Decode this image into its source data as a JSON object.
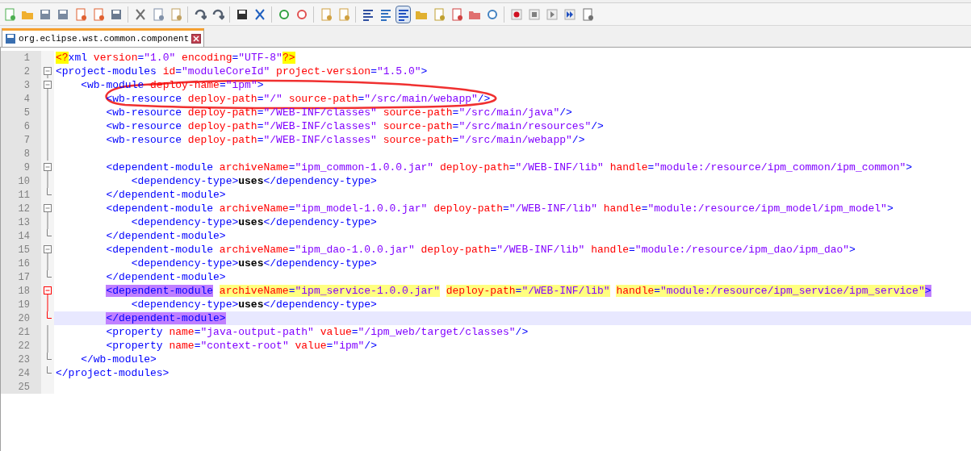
{
  "tab": {
    "title": "org.eclipse.wst.common.component",
    "selected": true
  },
  "lines": [
    {
      "number": "1",
      "segments": [
        {
          "kind": "pi",
          "text": "<?"
        },
        {
          "kind": "tag",
          "text": "xml "
        },
        {
          "kind": "attr",
          "text": "version"
        },
        {
          "kind": "eq",
          "text": "="
        },
        {
          "kind": "val",
          "text": "\"1.0\" "
        },
        {
          "kind": "attr",
          "text": "encoding"
        },
        {
          "kind": "eq",
          "text": "="
        },
        {
          "kind": "val",
          "text": "\"UTF-8\""
        },
        {
          "kind": "pi",
          "text": "?>"
        }
      ]
    },
    {
      "number": "2",
      "kind": "open",
      "active": false,
      "current": false,
      "segments": [
        {
          "kind": "tag",
          "text": "<project-modules "
        },
        {
          "kind": "attr",
          "text": "id"
        },
        {
          "kind": "eq",
          "text": "="
        },
        {
          "kind": "val",
          "text": "\"moduleCoreId\" "
        },
        {
          "kind": "attr",
          "text": "project-version"
        },
        {
          "kind": "eq",
          "text": "="
        },
        {
          "kind": "val",
          "text": "\"1.5.0\""
        },
        {
          "kind": "tag",
          "text": ">"
        }
      ]
    },
    {
      "number": "3",
      "kind": "open",
      "active": false,
      "current": false,
      "segments": [
        {
          "kind": "tag",
          "text": "    <wb-module "
        },
        {
          "kind": "attr",
          "text": "deploy-name"
        },
        {
          "kind": "eq",
          "text": "="
        },
        {
          "kind": "val",
          "text": "\"ipm\""
        },
        {
          "kind": "tag",
          "text": ">"
        }
      ]
    },
    {
      "number": "4",
      "kind": "line",
      "active": false,
      "current": false,
      "segments": [
        {
          "kind": "tag",
          "text": "        <wb-resource "
        },
        {
          "kind": "attr",
          "text": "deploy-path"
        },
        {
          "kind": "eq",
          "text": "="
        },
        {
          "kind": "val",
          "text": "\"/\" "
        },
        {
          "kind": "attr",
          "text": "source-path"
        },
        {
          "kind": "eq",
          "text": "="
        },
        {
          "kind": "val",
          "text": "\"/src/main/webapp\""
        },
        {
          "kind": "tag",
          "text": "/>"
        }
      ]
    },
    {
      "number": "5",
      "kind": "line",
      "active": false,
      "current": false,
      "segments": [
        {
          "kind": "tag",
          "text": "        <wb-resource "
        },
        {
          "kind": "attr",
          "text": "deploy-path"
        },
        {
          "kind": "eq",
          "text": "="
        },
        {
          "kind": "val",
          "text": "\"/WEB-INF/classes\" "
        },
        {
          "kind": "attr",
          "text": "source-path"
        },
        {
          "kind": "eq",
          "text": "="
        },
        {
          "kind": "val",
          "text": "\"/src/main/java\""
        },
        {
          "kind": "tag",
          "text": "/>"
        }
      ]
    },
    {
      "number": "6",
      "kind": "line",
      "active": false,
      "current": false,
      "segments": [
        {
          "kind": "tag",
          "text": "        <wb-resource "
        },
        {
          "kind": "attr",
          "text": "deploy-path"
        },
        {
          "kind": "eq",
          "text": "="
        },
        {
          "kind": "val",
          "text": "\"/WEB-INF/classes\" "
        },
        {
          "kind": "attr",
          "text": "source-path"
        },
        {
          "kind": "eq",
          "text": "="
        },
        {
          "kind": "val",
          "text": "\"/src/main/resources\""
        },
        {
          "kind": "tag",
          "text": "/>"
        }
      ]
    },
    {
      "number": "7",
      "kind": "line",
      "active": false,
      "current": false,
      "segments": [
        {
          "kind": "tag",
          "text": "        <wb-resource "
        },
        {
          "kind": "attr",
          "text": "deploy-path"
        },
        {
          "kind": "eq",
          "text": "="
        },
        {
          "kind": "val",
          "text": "\"/WEB-INF/classes\" "
        },
        {
          "kind": "attr",
          "text": "source-path"
        },
        {
          "kind": "eq",
          "text": "="
        },
        {
          "kind": "val",
          "text": "\"/src/main/webapp\""
        },
        {
          "kind": "tag",
          "text": "/>"
        }
      ]
    },
    {
      "number": "8",
      "kind": "line",
      "active": false,
      "current": false
    },
    {
      "number": "9",
      "kind": "open",
      "active": false,
      "current": false,
      "segments": [
        {
          "kind": "tag",
          "text": "        <dependent-module "
        },
        {
          "kind": "attr",
          "text": "archiveName"
        },
        {
          "kind": "eq",
          "text": "="
        },
        {
          "kind": "val",
          "text": "\"ipm_common-1.0.0.jar\" "
        },
        {
          "kind": "attr",
          "text": "deploy-path"
        },
        {
          "kind": "eq",
          "text": "="
        },
        {
          "kind": "val",
          "text": "\"/WEB-INF/lib\" "
        },
        {
          "kind": "attr",
          "text": "handle"
        },
        {
          "kind": "eq",
          "text": "="
        },
        {
          "kind": "val",
          "text": "\"module:/resource/ipm_common/ipm_common\""
        },
        {
          "kind": "tag",
          "text": ">"
        }
      ]
    },
    {
      "number": "10",
      "kind": "line",
      "active": false,
      "current": false,
      "segments": [
        {
          "kind": "tag",
          "text": "            <dependency-type>"
        },
        {
          "kind": "text",
          "text": "uses"
        },
        {
          "kind": "tag",
          "text": "</dependency-type>"
        }
      ]
    },
    {
      "number": "11",
      "kind": "end",
      "active": false,
      "current": false,
      "segments": [
        {
          "kind": "tag",
          "text": "        </dependent-module>"
        }
      ]
    },
    {
      "number": "12",
      "kind": "open",
      "active": false,
      "current": false,
      "segments": [
        {
          "kind": "tag",
          "text": "        <dependent-module "
        },
        {
          "kind": "attr",
          "text": "archiveName"
        },
        {
          "kind": "eq",
          "text": "="
        },
        {
          "kind": "val",
          "text": "\"ipm_model-1.0.0.jar\" "
        },
        {
          "kind": "attr",
          "text": "deploy-path"
        },
        {
          "kind": "eq",
          "text": "="
        },
        {
          "kind": "val",
          "text": "\"/WEB-INF/lib\" "
        },
        {
          "kind": "attr",
          "text": "handle"
        },
        {
          "kind": "eq",
          "text": "="
        },
        {
          "kind": "val",
          "text": "\"module:/resource/ipm_model/ipm_model\""
        },
        {
          "kind": "tag",
          "text": ">"
        }
      ]
    },
    {
      "number": "13",
      "kind": "line",
      "active": false,
      "current": false,
      "segments": [
        {
          "kind": "tag",
          "text": "            <dependency-type>"
        },
        {
          "kind": "text",
          "text": "uses"
        },
        {
          "kind": "tag",
          "text": "</dependency-type>"
        }
      ]
    },
    {
      "number": "14",
      "kind": "end",
      "active": false,
      "current": false,
      "segments": [
        {
          "kind": "tag",
          "text": "        </dependent-module>"
        }
      ]
    },
    {
      "number": "15",
      "kind": "open",
      "active": false,
      "current": false,
      "segments": [
        {
          "kind": "tag",
          "text": "        <dependent-module "
        },
        {
          "kind": "attr",
          "text": "archiveName"
        },
        {
          "kind": "eq",
          "text": "="
        },
        {
          "kind": "val",
          "text": "\"ipm_dao-1.0.0.jar\" "
        },
        {
          "kind": "attr",
          "text": "deploy-path"
        },
        {
          "kind": "eq",
          "text": "="
        },
        {
          "kind": "val",
          "text": "\"/WEB-INF/lib\" "
        },
        {
          "kind": "attr",
          "text": "handle"
        },
        {
          "kind": "eq",
          "text": "="
        },
        {
          "kind": "val",
          "text": "\"module:/resource/ipm_dao/ipm_dao\""
        },
        {
          "kind": "tag",
          "text": ">"
        }
      ]
    },
    {
      "number": "16",
      "kind": "line",
      "active": false,
      "current": false,
      "segments": [
        {
          "kind": "tag",
          "text": "            <dependency-type>"
        },
        {
          "kind": "text",
          "text": "uses"
        },
        {
          "kind": "tag",
          "text": "</dependency-type>"
        }
      ]
    },
    {
      "number": "17",
      "kind": "end",
      "active": false,
      "current": false,
      "segments": [
        {
          "kind": "tag",
          "text": "        </dependent-module>"
        }
      ]
    },
    {
      "number": "18",
      "kind": "open",
      "active": true,
      "current": false,
      "segments": [
        {
          "kind": "tag",
          "text": "        <dependent-module ",
          "matched": true,
          "highlighted": false
        },
        {
          "kind": "attr",
          "text": "archiveName",
          "matched": false,
          "highlighted": true
        },
        {
          "kind": "eq",
          "text": "=",
          "matched": false,
          "highlighted": true
        },
        {
          "kind": "val",
          "text": "\"ipm_service-1.0.0.jar\" ",
          "matched": false,
          "highlighted": true
        },
        {
          "kind": "attr",
          "text": "deploy-path",
          "matched": false,
          "highlighted": true
        },
        {
          "kind": "eq",
          "text": "=",
          "matched": false,
          "highlighted": true
        },
        {
          "kind": "val",
          "text": "\"/WEB-INF/lib\" ",
          "matched": false,
          "highlighted": true
        },
        {
          "kind": "attr",
          "text": "handle",
          "matched": false,
          "highlighted": true
        },
        {
          "kind": "eq",
          "text": "=",
          "matched": false,
          "highlighted": true
        },
        {
          "kind": "val",
          "text": "\"module:/resource/ipm_service/ipm_service\"",
          "matched": false,
          "highlighted": true
        },
        {
          "kind": "tag",
          "text": ">",
          "matched": true,
          "highlighted": false
        }
      ]
    },
    {
      "number": "19",
      "kind": "line",
      "active": true,
      "current": false,
      "segments": [
        {
          "kind": "tag",
          "text": "            <dependency-type>"
        },
        {
          "kind": "text",
          "text": "uses"
        },
        {
          "kind": "tag",
          "text": "</dependency-type>"
        }
      ]
    },
    {
      "number": "20",
      "kind": "end",
      "active": true,
      "current": true,
      "segments": [
        {
          "kind": "tag",
          "text": "        </dependent-module>",
          "matched": true
        }
      ]
    },
    {
      "number": "21",
      "kind": "line",
      "active": false,
      "current": false,
      "segments": [
        {
          "kind": "tag",
          "text": "        <property "
        },
        {
          "kind": "attr",
          "text": "name"
        },
        {
          "kind": "eq",
          "text": "="
        },
        {
          "kind": "val",
          "text": "\"java-output-path\" "
        },
        {
          "kind": "attr",
          "text": "value"
        },
        {
          "kind": "eq",
          "text": "="
        },
        {
          "kind": "val",
          "text": "\"/ipm_web/target/classes\""
        },
        {
          "kind": "tag",
          "text": "/>"
        }
      ]
    },
    {
      "number": "22",
      "kind": "line",
      "active": false,
      "current": false,
      "segments": [
        {
          "kind": "tag",
          "text": "        <property "
        },
        {
          "kind": "attr",
          "text": "name"
        },
        {
          "kind": "eq",
          "text": "="
        },
        {
          "kind": "val",
          "text": "\"context-root\" "
        },
        {
          "kind": "attr",
          "text": "value"
        },
        {
          "kind": "eq",
          "text": "="
        },
        {
          "kind": "val",
          "text": "\"ipm\""
        },
        {
          "kind": "tag",
          "text": "/>"
        }
      ]
    },
    {
      "number": "23",
      "kind": "end",
      "active": false,
      "current": false,
      "segments": [
        {
          "kind": "tag",
          "text": "    </wb-module>"
        }
      ]
    },
    {
      "number": "24",
      "kind": "end",
      "active": false,
      "current": false,
      "segments": [
        {
          "kind": "tag",
          "text": "</project-modules>"
        }
      ]
    },
    {
      "number": "25"
    }
  ]
}
